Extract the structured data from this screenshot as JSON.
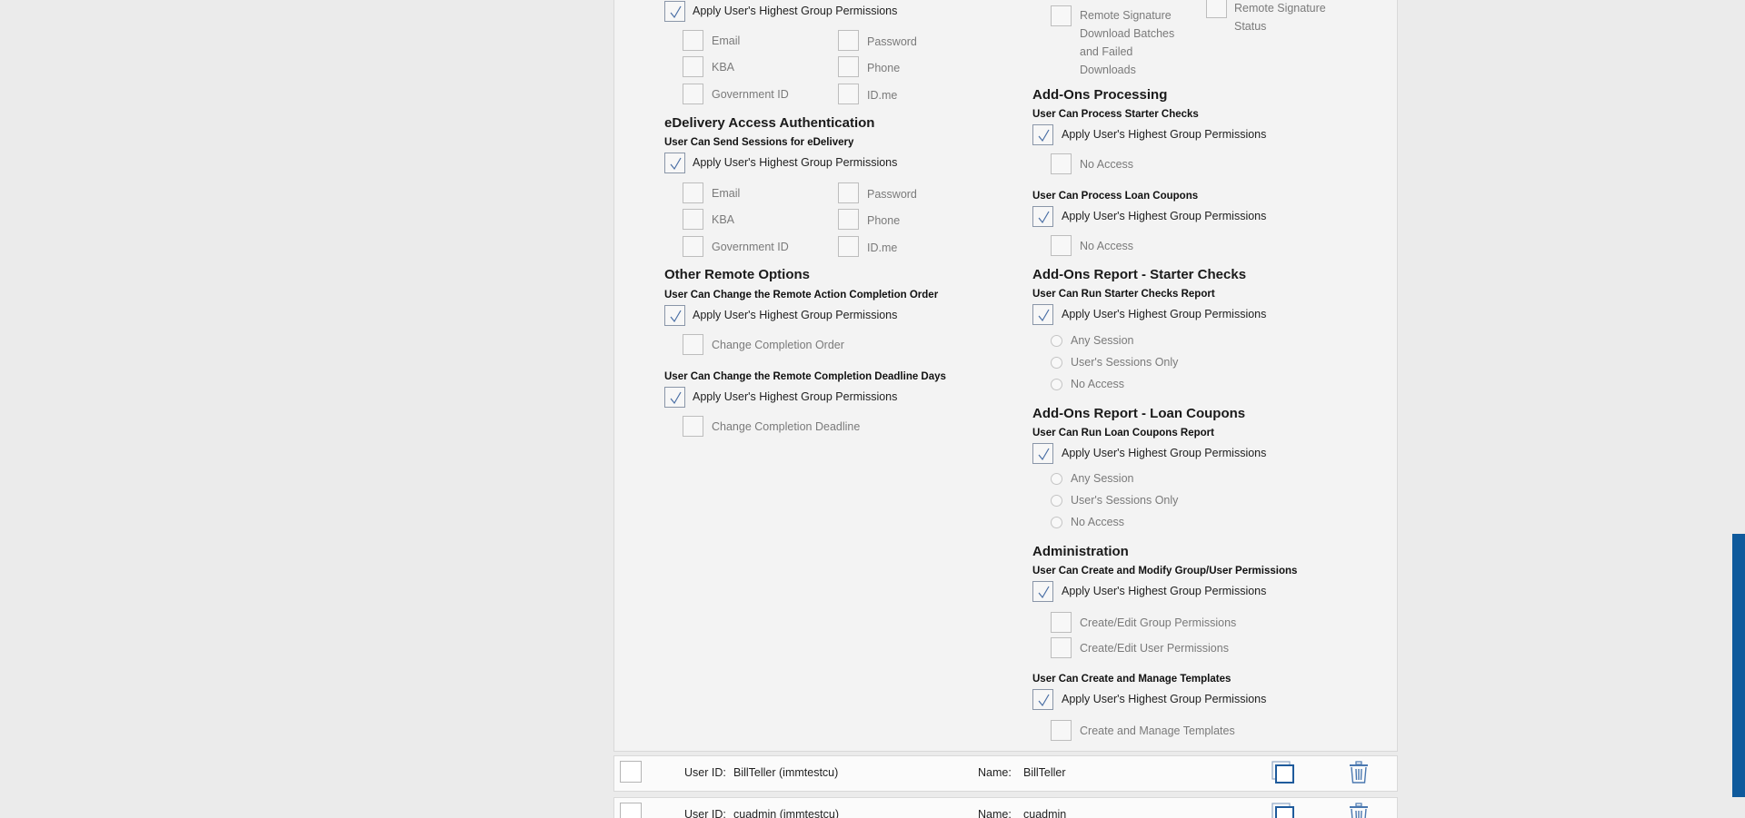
{
  "left": {
    "top_group": {
      "apply": "Apply User's Highest Group Permissions",
      "options": [
        "Email",
        "Password",
        "KBA",
        "Phone",
        "Government ID",
        "ID.me"
      ]
    },
    "edelivery": {
      "title": "eDelivery Access Authentication",
      "perm": "User Can Send Sessions for eDelivery",
      "apply": "Apply User's Highest Group Permissions",
      "options": [
        "Email",
        "Password",
        "KBA",
        "Phone",
        "Government ID",
        "ID.me"
      ]
    },
    "other_remote": {
      "title": "Other Remote Options",
      "perm1": "User Can Change the Remote Action Completion Order",
      "apply1": "Apply User's Highest Group Permissions",
      "opt1": "Change Completion Order",
      "perm2": "User Can Change the Remote Completion Deadline Days",
      "apply2": "Apply User's Highest Group Permissions",
      "opt2": "Change Completion Deadline"
    }
  },
  "right": {
    "top_opts": {
      "opt_a": "Remote Signature Download Batches and Failed Downloads",
      "opt_b": "Remote Signature Status"
    },
    "addons_processing": {
      "title": "Add-Ons Processing",
      "perm1": "User Can Process Starter Checks",
      "apply1": "Apply User's Highest Group Permissions",
      "opt1": "No Access",
      "perm2": "User Can Process Loan Coupons",
      "apply2": "Apply User's Highest Group Permissions",
      "opt2": "No Access"
    },
    "report_starter": {
      "title": "Add-Ons Report - Starter Checks",
      "perm": "User Can Run Starter Checks Report",
      "apply": "Apply User's Highest Group Permissions",
      "radios": [
        "Any Session",
        "User's Sessions Only",
        "No Access"
      ]
    },
    "report_loan": {
      "title": "Add-Ons Report - Loan Coupons",
      "perm": "User Can Run Loan Coupons Report",
      "apply": "Apply User's Highest Group Permissions",
      "radios": [
        "Any Session",
        "User's Sessions Only",
        "No Access"
      ]
    },
    "administration": {
      "title": "Administration",
      "perm1": "User Can Create and Modify Group/User Permissions",
      "apply1": "Apply User's Highest Group Permissions",
      "opts1": [
        "Create/Edit Group Permissions",
        "Create/Edit User Permissions"
      ],
      "perm2": "User Can Create and Manage Templates",
      "apply2": "Apply User's Highest Group Permissions",
      "opt2": "Create and Manage Templates"
    }
  },
  "users": [
    {
      "userid_label": "User ID:",
      "userid": "BillTeller (immtestcu)",
      "name_label": "Name:",
      "name": "BillTeller"
    },
    {
      "userid_label": "User ID:",
      "userid": "cuadmin (immtestcu)",
      "name_label": "Name:",
      "name": "cuadmin"
    }
  ],
  "colors": {
    "accent": "#0f5a9c",
    "panel_bg": "#f3f3f3",
    "page_bg": "#ebebeb"
  }
}
